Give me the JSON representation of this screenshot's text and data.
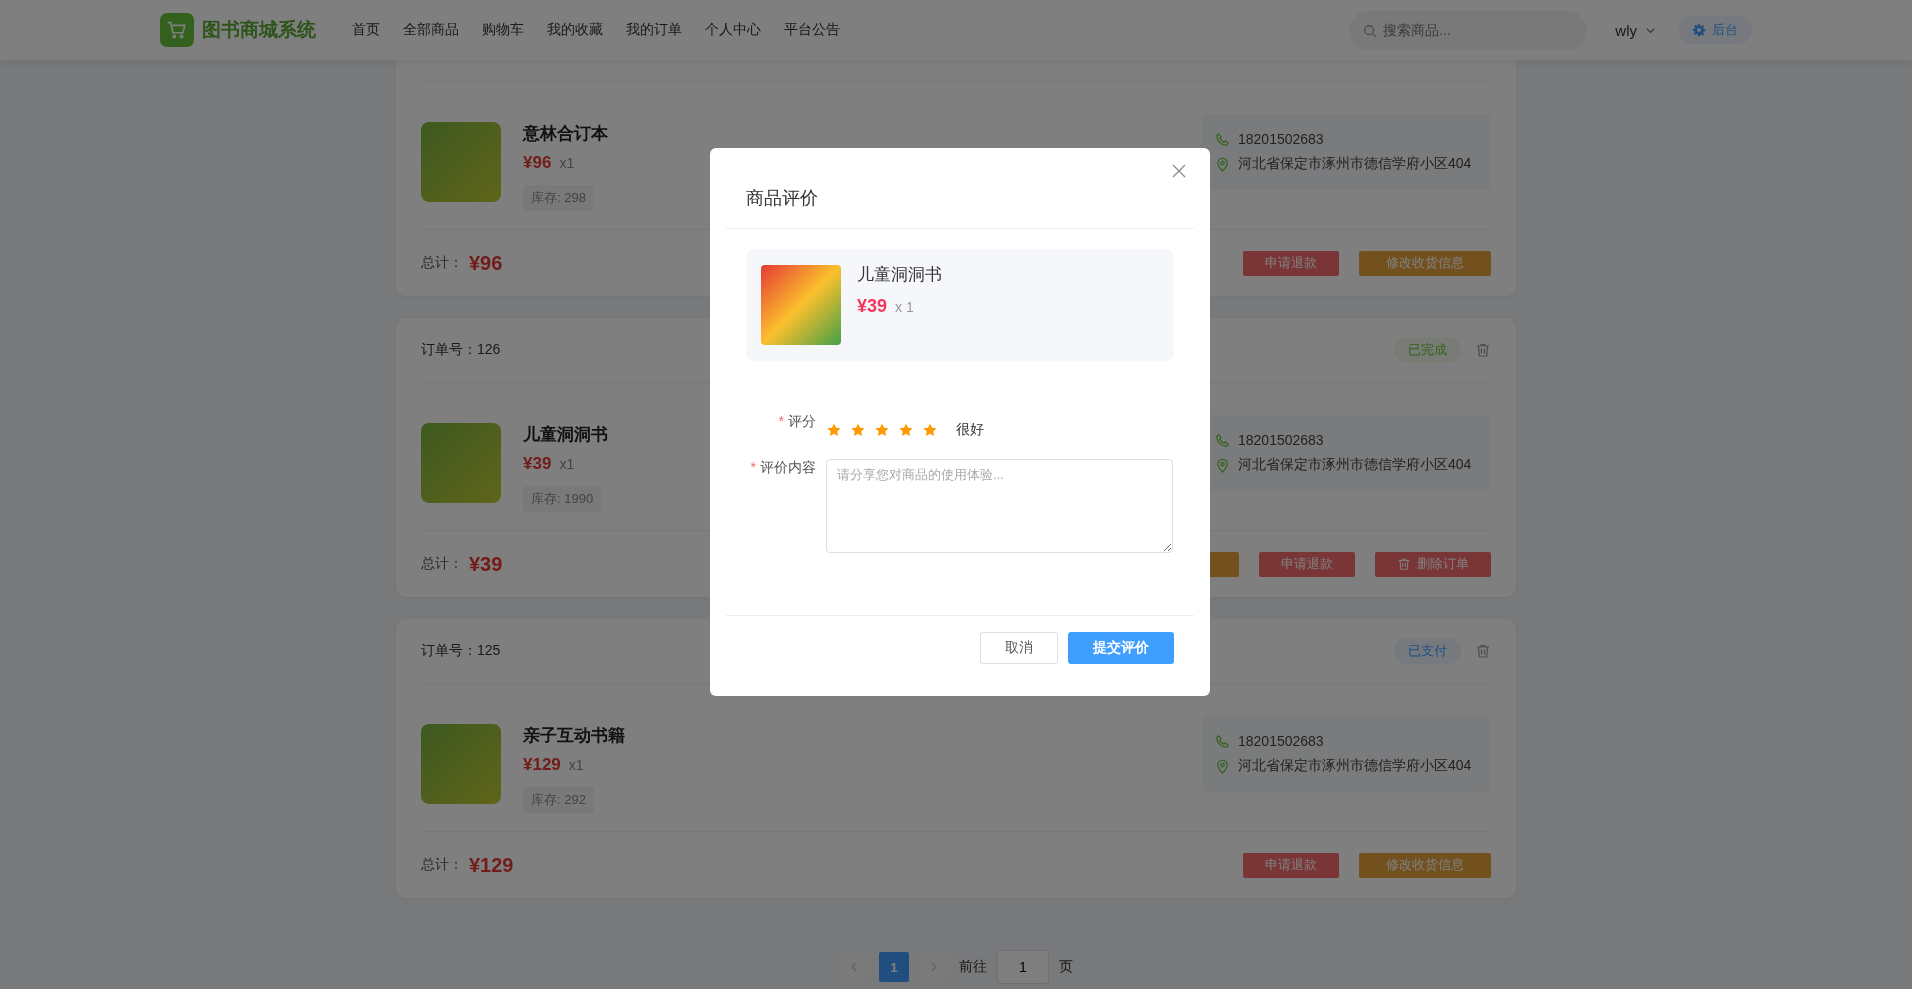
{
  "header": {
    "logo_text": "图书商城系统",
    "nav": [
      {
        "label": "首页"
      },
      {
        "label": "全部商品"
      },
      {
        "label": "购物车"
      },
      {
        "label": "我的收藏"
      },
      {
        "label": "我的订单"
      },
      {
        "label": "个人中心"
      },
      {
        "label": "平台公告"
      }
    ],
    "search": {
      "placeholder": "搜索商品..."
    },
    "user": "wly",
    "admin_button": "后台"
  },
  "orders": [
    {
      "product": {
        "name": "意林合订本",
        "price": "¥96",
        "qty": "x1",
        "stock": "库存: 298"
      },
      "contact": {
        "phone": "18201502683",
        "address": "河北省保定市涿州市德信学府小区404"
      },
      "total_label": "总计：",
      "total": "¥96",
      "actions": [
        {
          "kind": "danger",
          "label": "申请退款"
        },
        {
          "kind": "warning",
          "label": "修改收货信息"
        }
      ]
    },
    {
      "order_label": "订单号：126",
      "status": {
        "label": "已完成",
        "kind": "success"
      },
      "product": {
        "name": "儿童洞洞书",
        "price": "¥39",
        "qty": "x1",
        "stock": "库存: 1990"
      },
      "contact": {
        "phone": "18201502683",
        "address": "河北省保定市涿州市德信学府小区404"
      },
      "total_label": "总计：",
      "total": "¥39",
      "actions": [
        {
          "kind": "warning"
        },
        {
          "kind": "danger",
          "label": "申请退款"
        },
        {
          "kind": "delete",
          "label": "删除订单"
        }
      ]
    },
    {
      "order_label": "订单号：125",
      "status": {
        "label": "已支付",
        "kind": "info"
      },
      "product": {
        "name": "亲子互动书籍",
        "price": "¥129",
        "qty": "x1",
        "stock": "库存: 292"
      },
      "contact": {
        "phone": "18201502683",
        "address": "河北省保定市涿州市德信学府小区404"
      },
      "total_label": "总计：",
      "total": "¥129",
      "actions": [
        {
          "kind": "danger",
          "label": "申请退款"
        },
        {
          "kind": "warning",
          "label": "修改收货信息"
        }
      ]
    }
  ],
  "pagination": {
    "pages": [
      {
        "label": "1",
        "selected": true
      }
    ],
    "goto_label": "前往",
    "goto_value": "1",
    "page_suffix": "页"
  },
  "dialog": {
    "title": "商品评价",
    "product": {
      "name": "儿童洞洞书",
      "price": "¥39",
      "qty": "x 1"
    },
    "rating": {
      "mark": "*",
      "label": "评分",
      "stars": 5,
      "text": "很好"
    },
    "content": {
      "mark": "*",
      "label": "评价内容",
      "placeholder": "请分享您对商品的使用体验..."
    },
    "cancel": "取消",
    "submit": "提交评价"
  }
}
